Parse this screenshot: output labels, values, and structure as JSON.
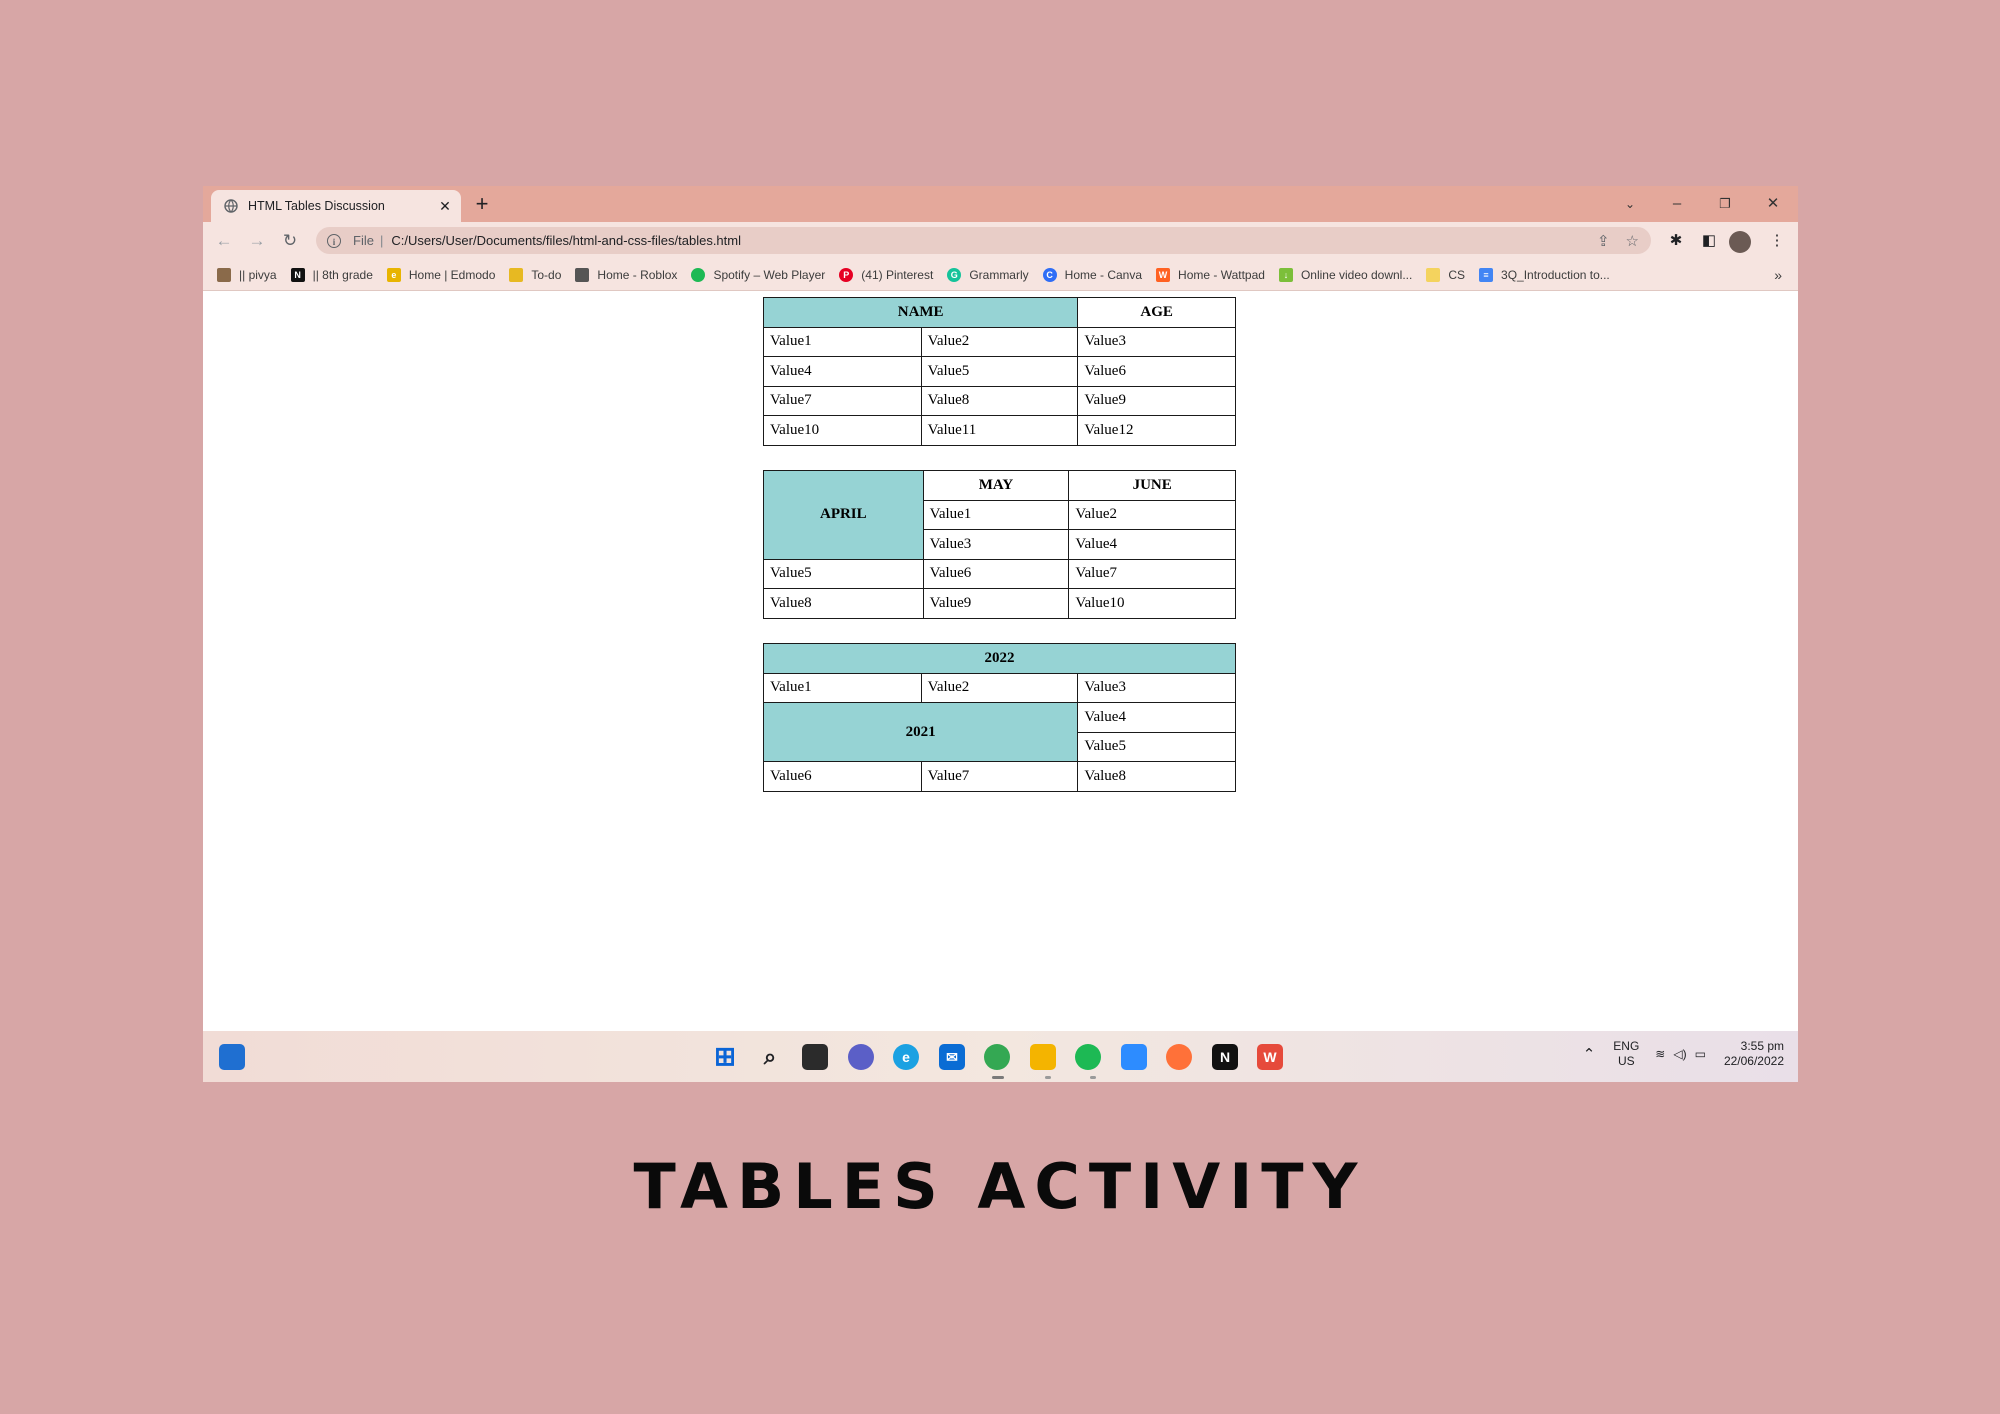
{
  "browser": {
    "tab_title": "HTML Tables Discussion",
    "url_scheme": "File",
    "url": "C:/Users/User/Documents/files/html-and-css-files/tables.html"
  },
  "bookmarks": [
    {
      "label": "|| pivya",
      "color": "#8a6a4a"
    },
    {
      "label": "|| 8th grade",
      "color": "#111111"
    },
    {
      "label": "Home | Edmodo",
      "color": "#e8b400"
    },
    {
      "label": "To-do",
      "color": "#e7b922"
    },
    {
      "label": "Home - Roblox",
      "color": "#555555"
    },
    {
      "label": "Spotify – Web Player",
      "color": "#1db954"
    },
    {
      "label": "(41) Pinterest",
      "color": "#e60023"
    },
    {
      "label": "Grammarly",
      "color": "#15c39a"
    },
    {
      "label": "Home - Canva",
      "color": "#2f6df6"
    },
    {
      "label": "Home - Wattpad",
      "color": "#ff6122"
    },
    {
      "label": "Online video downl...",
      "color": "#7cbf3a"
    },
    {
      "label": "CS",
      "color": "#f4d35e"
    },
    {
      "label": "3Q_Introduction to...",
      "color": "#4285f4"
    }
  ],
  "table1": {
    "header": [
      "NAME",
      "AGE"
    ],
    "rows": [
      [
        "Value1",
        "Value2",
        "Value3"
      ],
      [
        "Value4",
        "Value5",
        "Value6"
      ],
      [
        "Value7",
        "Value8",
        "Value9"
      ],
      [
        "Value10",
        "Value11",
        "Value12"
      ]
    ]
  },
  "table2": {
    "header": [
      "APRIL",
      "MAY",
      "JUNE"
    ],
    "rows": [
      [
        "Value1",
        "Value2"
      ],
      [
        "Value3",
        "Value4"
      ],
      [
        "Value5",
        "Value6",
        "Value7"
      ],
      [
        "Value8",
        "Value9",
        "Value10"
      ]
    ]
  },
  "table3": {
    "header": "2022",
    "row1": [
      "Value1",
      "Value2",
      "Value3"
    ],
    "span_label": "2021",
    "span_values": [
      "Value4",
      "Value5"
    ],
    "row4": [
      "Value6",
      "Value7",
      "Value8"
    ]
  },
  "tray": {
    "lang": "ENG",
    "region": "US",
    "time": "3:55 pm",
    "date": "22/06/2022"
  },
  "caption": "TABLES ACTIVITY",
  "colors": {
    "teal": "#96d3d4",
    "background": "#d7a6a6",
    "tabstrip": "#e4a89b"
  }
}
